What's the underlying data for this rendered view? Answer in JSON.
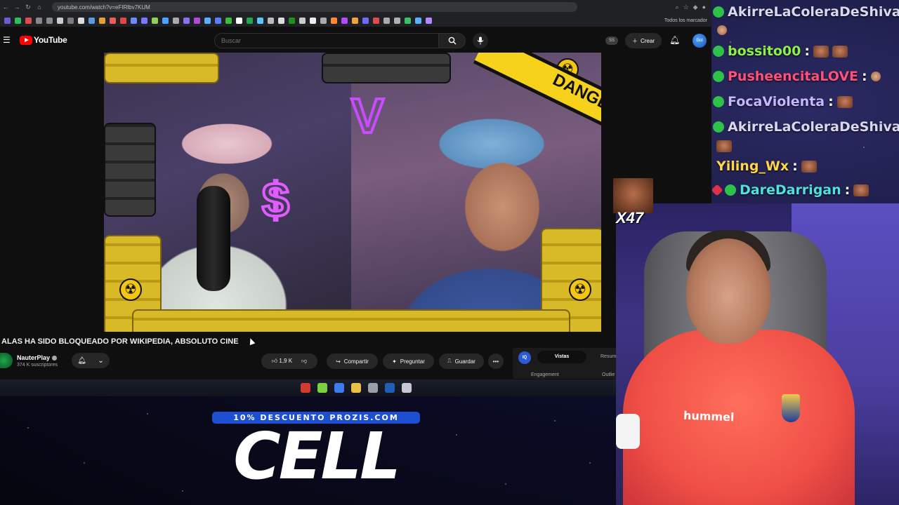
{
  "browser": {
    "url": "youtube.com/watch?v=eFIRlbv7KUM",
    "bookmarks_label": "Todos los marcador",
    "bookmark_colors": [
      "#6b5bd6",
      "#2bbf62",
      "#e14b4b",
      "#888888",
      "#8a8a8a",
      "#cccccc",
      "#7a7a7a",
      "#dddddd",
      "#5a9be0",
      "#e5a02a",
      "#f05a5a",
      "#e64545",
      "#6b8cff",
      "#7777ff",
      "#8fd05a",
      "#4aa3ff",
      "#aaaaaa",
      "#8e6ef5",
      "#b04bd8",
      "#5ab0ff",
      "#5b7cff",
      "#3bbf3b",
      "#ffffff",
      "#1ca84b",
      "#59c7ff",
      "#bbbbbb",
      "#dddddd",
      "#1f8f1f",
      "#cccccc",
      "#eeeeee",
      "#aaaaaa",
      "#ff8833",
      "#b04bff",
      "#f2a23c",
      "#6b6bff",
      "#e14b4b",
      "#aaaaaa",
      "#b0b0b0",
      "#3bbf62",
      "#5ab0ff",
      "#b388ff"
    ]
  },
  "youtube": {
    "logo_text": "YouTube",
    "search_placeholder": "Buscar",
    "ss_badge": "SS",
    "create_label": "Crear",
    "avatar_text": "Gol"
  },
  "video": {
    "danger_text": "DANGER",
    "title": "ALAS HA SIDO BLOQUEADO POR WIKIPEDIA, ABSOLUTO CINE",
    "channel_name": "NauterPlay",
    "subscribers": "374 K suscriptores",
    "like_count": "1,9 K",
    "share_label": "Compartir",
    "ask_label": "Preguntar",
    "save_label": "Guardar",
    "more_label": "•••"
  },
  "side_panel": {
    "icon_text": "IQ",
    "tab_active": "Vistas",
    "tab_other": "Resum",
    "sub_left": "Engagement",
    "sub_right": "Outlie"
  },
  "taskbar": {
    "icon_colors": [
      "#d33b2e",
      "#7bd142",
      "#3d7bf0",
      "#e8c14a",
      "#9aa0a6",
      "#1f5fb8",
      "#c7c7d6"
    ]
  },
  "sponsor": {
    "banner": "10% DESCUENTO PROZIS.COM",
    "word": "CELL"
  },
  "chat": {
    "messages": [
      {
        "user": "AkirreLaColeraDeShiva",
        "sep": ":",
        "color": "#d9d6f0"
      },
      {
        "user": "bossito00",
        "sep": ":",
        "color": "#8cf04b"
      },
      {
        "user": "PusheencitaLOVE",
        "sep": ":",
        "color": "#ff4f7a"
      },
      {
        "user": "FocaViolenta",
        "sep": ":",
        "color": "#c8b6ff"
      },
      {
        "user": "AkirreLaColeraDeShiva",
        "sep": ":",
        "color": "#d9d6f0"
      },
      {
        "user": "Yiling_Wx",
        "sep": ":",
        "color": "#ffd54a"
      },
      {
        "user": "DareDarrigan",
        "sep": ":",
        "color": "#4fe0e0"
      }
    ],
    "overlay_emote_count": "X47"
  },
  "webcam": {
    "shirt_brand": "hummel"
  }
}
